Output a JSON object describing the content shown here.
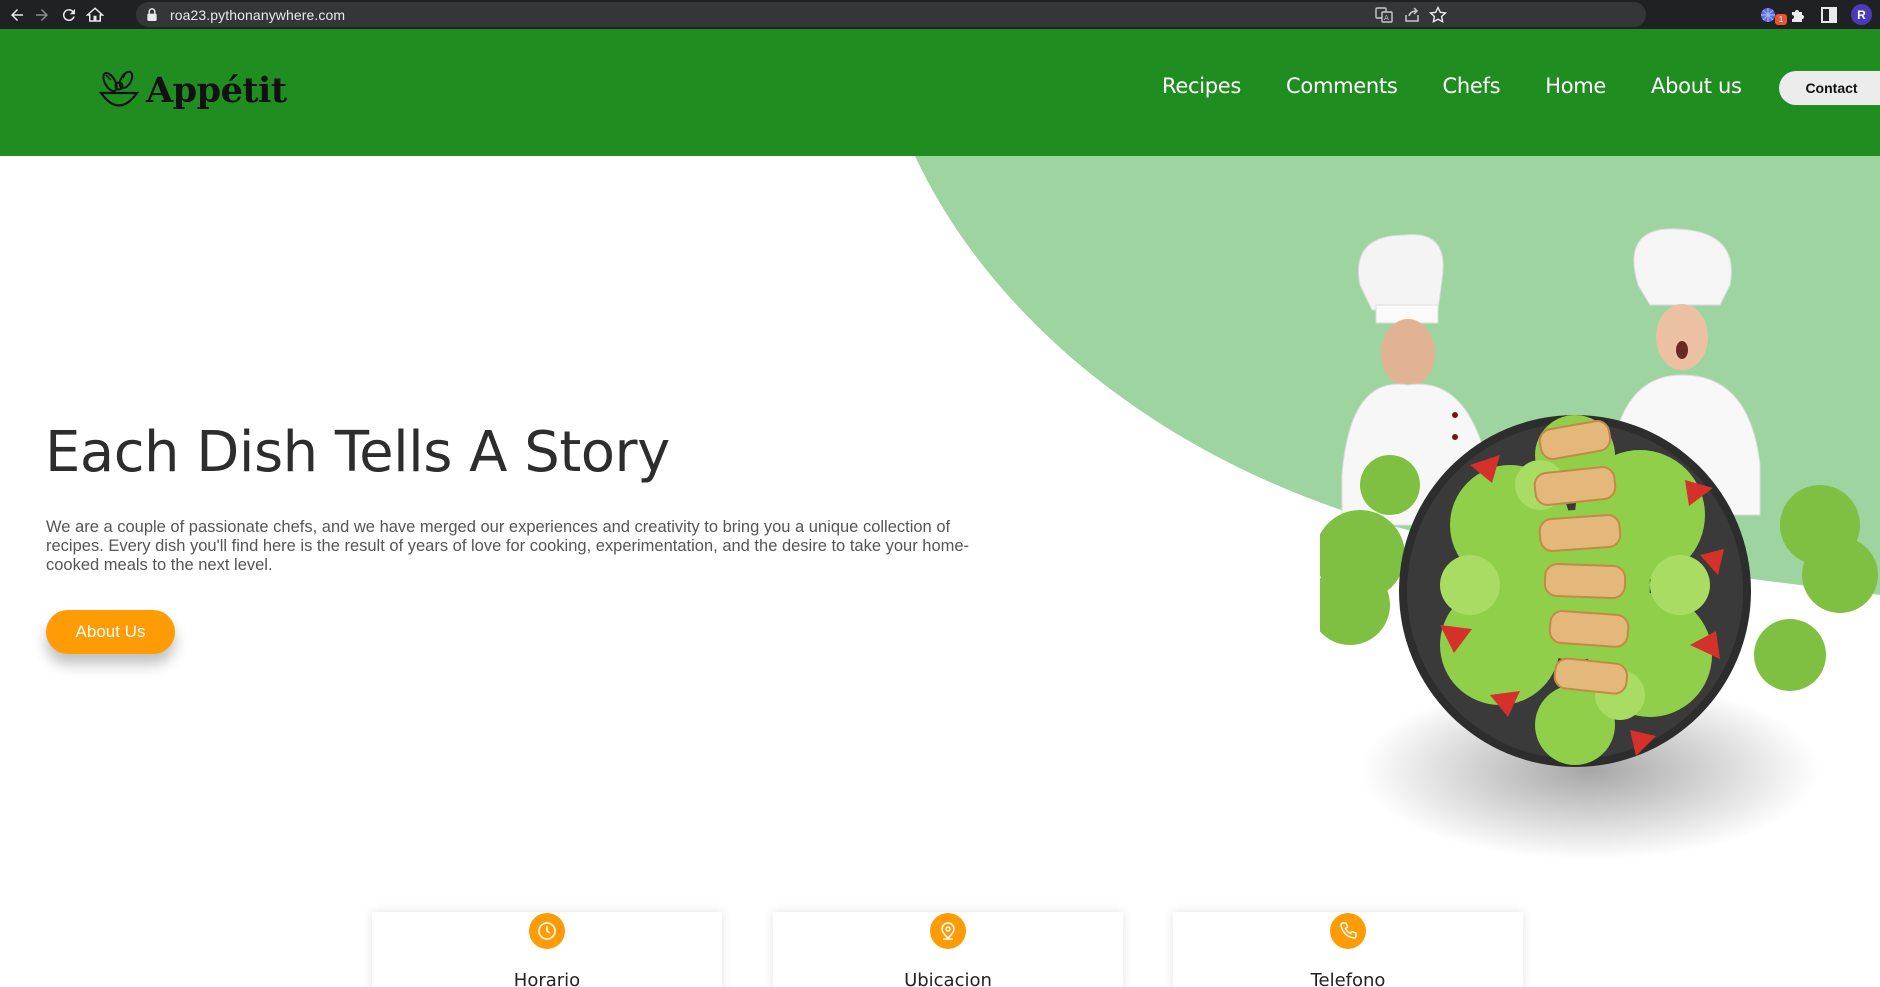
{
  "browser": {
    "url": "roa23.pythonanywhere.com",
    "profile_initial": "R",
    "extension_badge": "1"
  },
  "site": {
    "brand": "Appétit",
    "nav": [
      "Recipes",
      "Comments",
      "Chefs",
      "Home",
      "About us"
    ],
    "contact_label": "Contact"
  },
  "hero": {
    "title": "Each Dish Tells A Story",
    "text": "We are a couple of passionate chefs, and we have merged our experiences and creativity to bring you a unique collection of recipes. Every dish you'll find here is the result of years of love for cooking, experimentation, and the desire to take your home-cooked meals to the next level.",
    "button_label": "About Us"
  },
  "cards": [
    {
      "title": "Horario",
      "icon": "clock-icon"
    },
    {
      "title": "Ubicacion",
      "icon": "location-pin-icon"
    },
    {
      "title": "Telefono",
      "icon": "phone-icon"
    }
  ],
  "colors": {
    "header_green": "#1f8d1f",
    "light_green": "#9ed4a0",
    "accent_orange": "#ff9b05",
    "chrome_dark": "#202124"
  }
}
